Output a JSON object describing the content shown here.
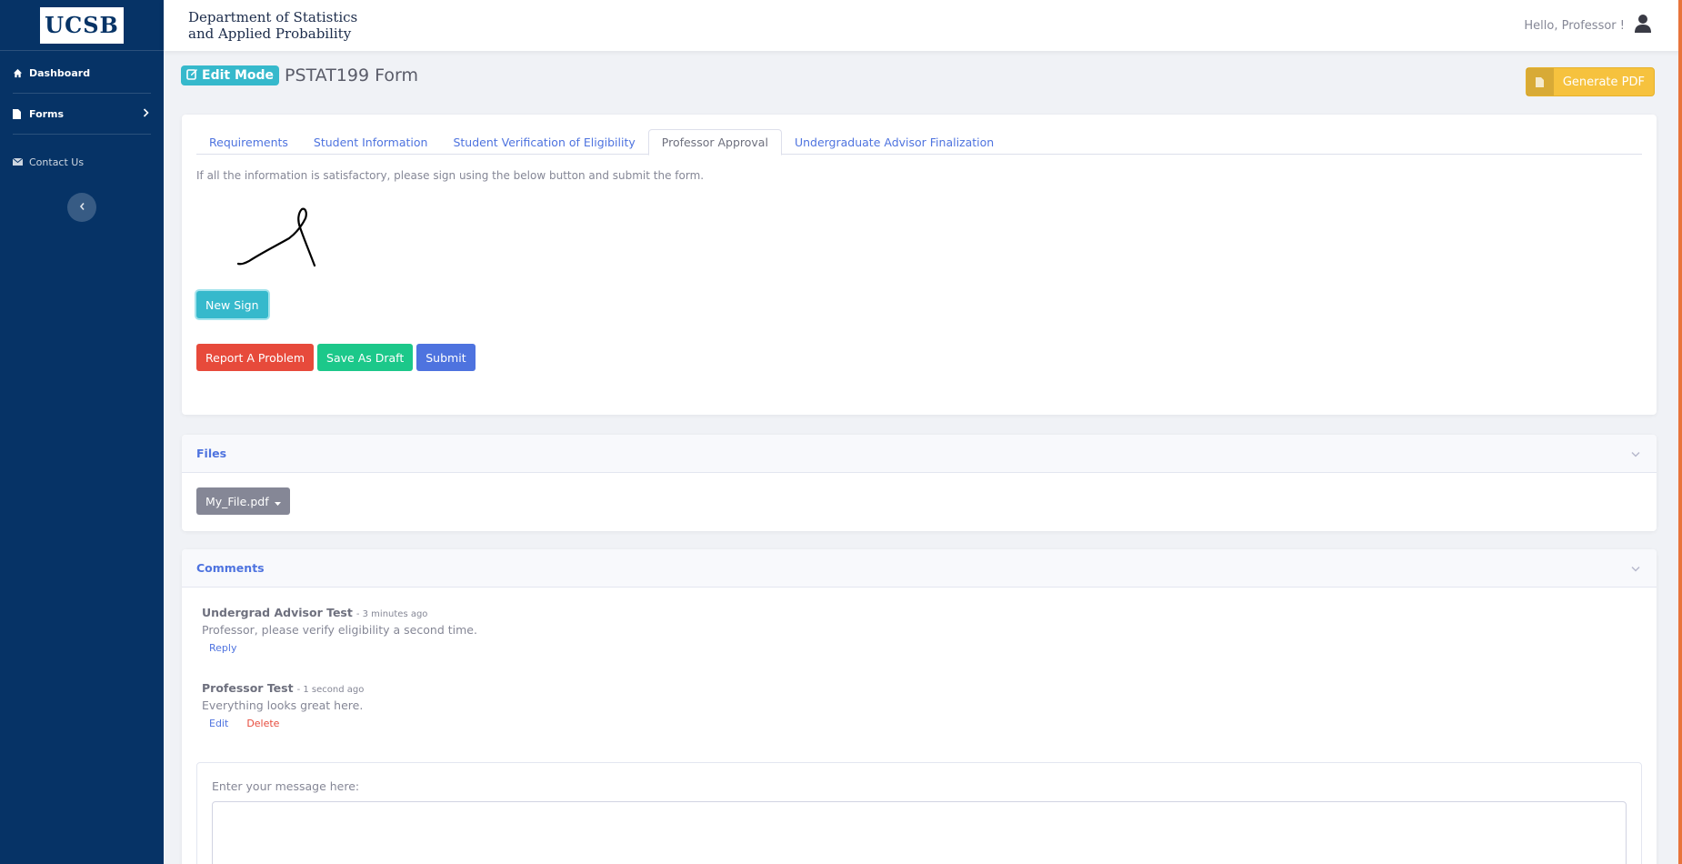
{
  "sidebar": {
    "logo": "UCSB",
    "items": [
      {
        "label": "Dashboard",
        "icon": "home-icon"
      },
      {
        "label": "Forms",
        "icon": "file-icon"
      },
      {
        "label": "Contact Us",
        "icon": "envelope-icon"
      }
    ],
    "collapse_icon": "chevron-left-icon"
  },
  "header": {
    "dept_line1": "Department of Statistics",
    "dept_line2": "and Applied Probability",
    "greeting": "Hello, Professor !",
    "user_icon": "user-icon"
  },
  "page": {
    "mode_badge": "Edit Mode",
    "title": "PSTAT199 Form",
    "generate_pdf": "Generate PDF"
  },
  "tabs": [
    {
      "label": "Requirements",
      "active": false
    },
    {
      "label": "Student Information",
      "active": false
    },
    {
      "label": "Student Verification of Eligibility",
      "active": false
    },
    {
      "label": "Professor Approval",
      "active": true
    },
    {
      "label": "Undergraduate Advisor Finalization",
      "active": false
    }
  ],
  "approval": {
    "instructions": "If all the information is satisfactory, please sign using the below button and submit the form.",
    "new_sign": "New Sign",
    "report": "Report A Problem",
    "save_draft": "Save As Draft",
    "submit": "Submit"
  },
  "files": {
    "title": "Files",
    "file_button": "My_File.pdf"
  },
  "comments": {
    "title": "Comments",
    "items": [
      {
        "author": "Undergrad Advisor Test",
        "time": "- 3 minutes ago",
        "text": "Professor, please verify eligibility a second time.",
        "actions": [
          "Reply"
        ]
      },
      {
        "author": "Professor Test",
        "time": "- 1 second ago",
        "text": "Everything looks great here.",
        "actions": [
          "Edit",
          "Delete"
        ]
      }
    ],
    "message_label": "Enter your message here:"
  },
  "colors": {
    "sidebar": "#063366",
    "info": "#36b9cc",
    "warning": "#f6c23e",
    "danger": "#e74a3b",
    "success": "#1cc88a",
    "primary": "#4e73df",
    "secondary": "#858796"
  }
}
